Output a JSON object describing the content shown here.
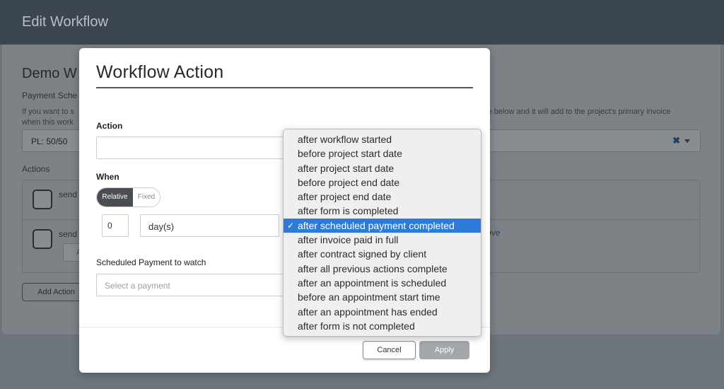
{
  "background": {
    "header_title": "Edit Workflow",
    "panel_title": "Demo W",
    "schedule_label": "Payment Sche",
    "hint_left_1": "If you want to s",
    "hint_left_2": "when this work",
    "hint_right": "ule below and it will add to the project's primary invoice",
    "schedule_value": "PL: 50/50",
    "actions_label": "Actions",
    "row1_text": "send",
    "row2_text": "send",
    "row2_button": "A",
    "row2_link": "ove",
    "add_action_label": "Add Action"
  },
  "modal": {
    "title": "Workflow Action",
    "action_label": "Action",
    "action_value": "",
    "when_label": "When",
    "toggle": {
      "relative": "Relative",
      "fixed": "Fixed",
      "active": "Relative"
    },
    "amount_value": "0",
    "unit_value": "day(s)",
    "watch_label": "Scheduled Payment to watch",
    "watch_placeholder": "Select a payment",
    "cancel_label": "Cancel",
    "apply_label": "Apply"
  },
  "dropdown": {
    "selected_index": 6,
    "check_glyph": "✓",
    "options": [
      "after workflow started",
      "before project start date",
      "after project start date",
      "before project end date",
      "after project end date",
      "after form is completed",
      "after scheduled payment completed",
      "after invoice paid in full",
      "after contract signed by client",
      "after all previous actions complete",
      "after an appointment is scheduled",
      "before an appointment start time",
      "after an appointment has ended",
      "after form is not completed"
    ]
  },
  "colors": {
    "accent": "#2c7bd8",
    "header": "#3b4650",
    "overlay": "#6e747b"
  }
}
